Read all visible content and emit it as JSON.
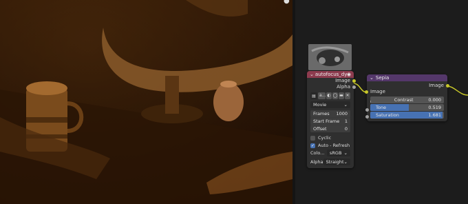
{
  "image_node": {
    "title": "autofocus_dyna...",
    "outputs": [
      "Image",
      "Alpha"
    ],
    "image_name": "a...",
    "source": "Movie",
    "frames_label": "Frames",
    "frames_value": "1000",
    "start_label": "Start Frame",
    "start_value": "1",
    "offset_label": "Offset",
    "offset_value": "0",
    "cyclic_label": "Cyclic",
    "autorefresh_label": "Auto - Refresh",
    "color_label": "Colo...",
    "color_value": "sRGB",
    "alpha_label": "Alpha",
    "alpha_value": "Straight"
  },
  "sepia_node": {
    "title": "Sepia",
    "output": "Image",
    "input": "Image",
    "contrast_label": "Contrast",
    "contrast_value": "0.000",
    "tone_label": "Tone",
    "tone_value": "0.519",
    "saturation_label": "Saturation",
    "saturation_value": "1.681"
  },
  "colors": {
    "image_header": "#8d3b4e",
    "sepia_header": "#54376a",
    "socket_image": "#c7c729",
    "accent": "#4772b3"
  },
  "levels": {
    "tone": 0.519,
    "saturation": 0.98
  }
}
